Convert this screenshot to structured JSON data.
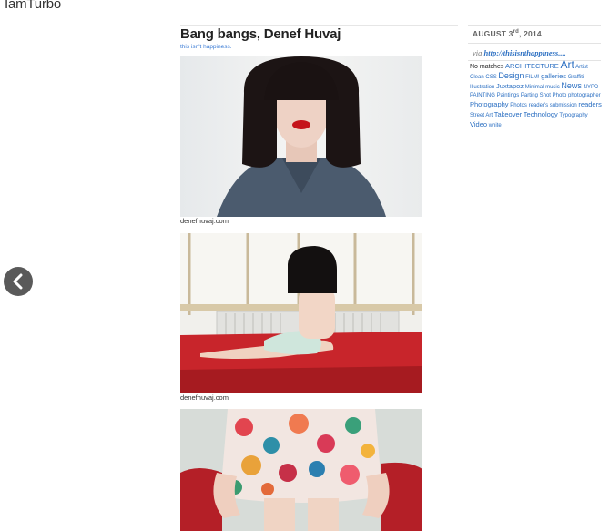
{
  "site": {
    "title": "IamTurbo"
  },
  "nav": {
    "prev_label": "previous post"
  },
  "post": {
    "title": "Bang bangs, Denef Huvaj",
    "subtitle": "this isn't happiness.",
    "captions": [
      "denefhuvaj.com",
      "denefhuvaj.com"
    ]
  },
  "sidebar": {
    "date_main": "AUGUST 3",
    "date_suffix": "rd",
    "date_year": ", 2014",
    "via_label": "via",
    "via_link": "http://thisisnthappiness....",
    "no_matches": "No matches",
    "tags": [
      {
        "label": "ARCHITECTURE",
        "size": 2
      },
      {
        "label": "Art",
        "size": 4
      },
      {
        "label": "Artist",
        "size": 1
      },
      {
        "label": "Clean",
        "size": 1
      },
      {
        "label": "CSS",
        "size": 1
      },
      {
        "label": "Design",
        "size": 3
      },
      {
        "label": "FILM!",
        "size": 1
      },
      {
        "label": "galleries",
        "size": 2
      },
      {
        "label": "Graffiti",
        "size": 1
      },
      {
        "label": "Illustration",
        "size": 1
      },
      {
        "label": "Juxtapoz",
        "size": 2
      },
      {
        "label": "Minimal",
        "size": 1
      },
      {
        "label": "music",
        "size": 1
      },
      {
        "label": "News",
        "size": 3
      },
      {
        "label": "NYPD",
        "size": 1
      },
      {
        "label": "PAINTING",
        "size": 1
      },
      {
        "label": "Paintings",
        "size": 1
      },
      {
        "label": "Parting Shot",
        "size": 1
      },
      {
        "label": "Photo",
        "size": 1
      },
      {
        "label": "photographer",
        "size": 1
      },
      {
        "label": "Photography",
        "size": 2
      },
      {
        "label": "Photos",
        "size": 1
      },
      {
        "label": "reader's submission",
        "size": 1
      },
      {
        "label": "readers",
        "size": 2
      },
      {
        "label": "Street Art",
        "size": 1
      },
      {
        "label": "Takeover",
        "size": 2
      },
      {
        "label": "Technology",
        "size": 2
      },
      {
        "label": "Typography",
        "size": 1
      },
      {
        "label": "Video",
        "size": 2
      },
      {
        "label": "white",
        "size": 1
      }
    ]
  },
  "colors": {
    "link": "#2b6fc2",
    "nav_button": "#5a5a5a"
  }
}
